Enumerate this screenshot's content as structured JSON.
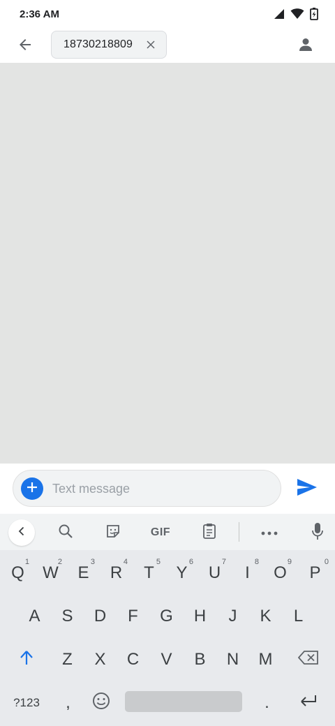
{
  "status_bar": {
    "time": "2:36 AM",
    "icons": [
      "signal-icon",
      "wifi-icon",
      "battery-charging-icon"
    ]
  },
  "app_bar": {
    "recipient": "18730218809",
    "icons": [
      "back-arrow-icon",
      "close-icon",
      "contact-person-icon"
    ]
  },
  "compose": {
    "placeholder": "Text message",
    "value": "",
    "icons": [
      "add-icon",
      "send-icon"
    ]
  },
  "keyboard": {
    "toolbar": {
      "gif_label": "GIF",
      "icons": [
        "chevron-left-icon",
        "search-icon",
        "sticker-icon",
        "clipboard-icon",
        "more-dots-icon",
        "mic-icon"
      ]
    },
    "row1": [
      {
        "key": "Q",
        "hint": "1"
      },
      {
        "key": "W",
        "hint": "2"
      },
      {
        "key": "E",
        "hint": "3"
      },
      {
        "key": "R",
        "hint": "4"
      },
      {
        "key": "T",
        "hint": "5"
      },
      {
        "key": "Y",
        "hint": "6"
      },
      {
        "key": "U",
        "hint": "7"
      },
      {
        "key": "I",
        "hint": "8"
      },
      {
        "key": "O",
        "hint": "9"
      },
      {
        "key": "P",
        "hint": "0"
      }
    ],
    "row2": [
      "A",
      "S",
      "D",
      "F",
      "G",
      "H",
      "J",
      "K",
      "L"
    ],
    "row3": [
      "Z",
      "X",
      "C",
      "V",
      "B",
      "N",
      "M"
    ],
    "row4": {
      "symbols": "?123",
      "comma": ",",
      "period": "."
    },
    "colors": {
      "accent": "#1a73e8",
      "shift": "#1a73e8",
      "background": "#e8eaed"
    }
  },
  "colors": {
    "conversation_bg": "#e3e4e3",
    "send": "#1a73e8"
  }
}
